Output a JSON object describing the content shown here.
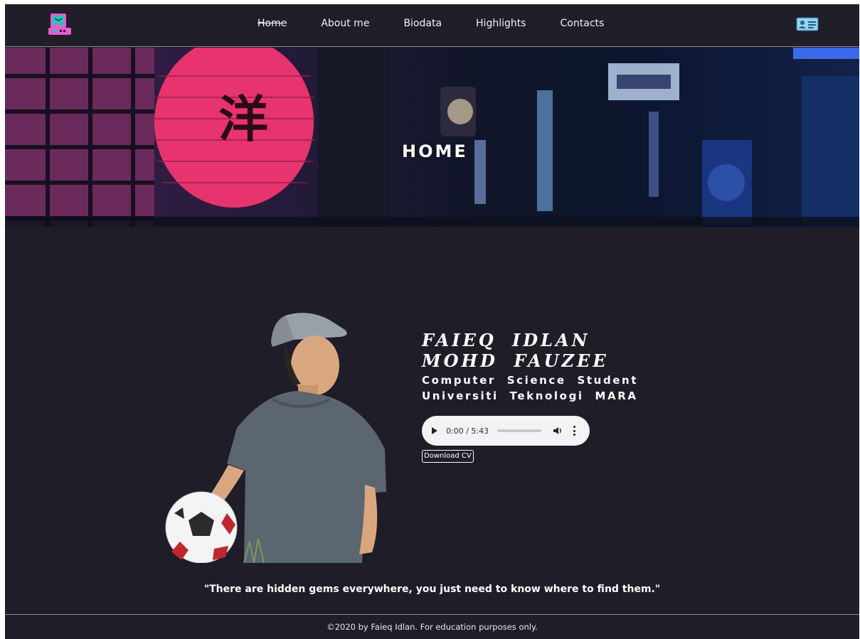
{
  "nav": {
    "logo_icon": "retro-computer-icon",
    "links": [
      {
        "label": "Home",
        "active": true
      },
      {
        "label": "About me"
      },
      {
        "label": "Biodata"
      },
      {
        "label": "Highlights"
      },
      {
        "label": "Contacts"
      }
    ],
    "right_icon": "id-card-icon"
  },
  "hero": {
    "title": "HOME"
  },
  "profile": {
    "name_line1": "FAIEQ IDLAN",
    "name_line2": "MOHD FAUZEE",
    "subtitle_line1": "Computer Science Student",
    "subtitle_line2": "Universiti Teknologi MARA"
  },
  "audio": {
    "time": "0:00 / 5:43"
  },
  "download_label": "Download CV",
  "quote": "\"There are hidden gems everywhere, you just need to know where to find them.\"",
  "footer": "©2020 by Faieq Idlan. For education purposes only.",
  "colors": {
    "background": "#1e1d28",
    "lantern": "#e8346e",
    "logo_pink": "#e85ccb",
    "logo_screen": "#2ac1b8"
  }
}
